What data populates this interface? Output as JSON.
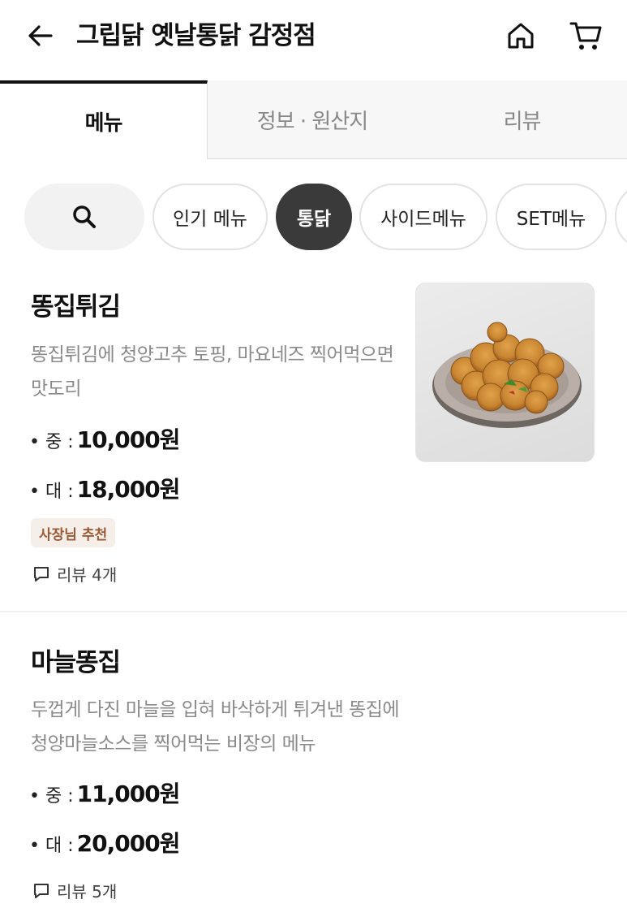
{
  "header": {
    "title": "그립닭 옛날통닭 감정점",
    "icons": {
      "back": "arrow-left-icon",
      "home": "home-icon",
      "cart": "cart-icon"
    }
  },
  "tabs": [
    {
      "label": "메뉴",
      "active": true
    },
    {
      "label": "정보 · 원산지",
      "active": false
    },
    {
      "label": "리뷰",
      "active": false
    }
  ],
  "categories": [
    {
      "label": "인기 메뉴",
      "active": false
    },
    {
      "label": "통닭",
      "active": true
    },
    {
      "label": "사이드메뉴",
      "active": false
    },
    {
      "label": "SET메뉴",
      "active": false
    }
  ],
  "menu_items": [
    {
      "name": "똥집튀김",
      "description_lines": [
        "똥집튀김에 청양고추 토핑, 마요네즈 찍어먹으면",
        "맛도리"
      ],
      "prices": [
        {
          "label": "• 중 :",
          "value": "10,000원"
        },
        {
          "label": "• 대 :",
          "value": "18,000원"
        }
      ],
      "badge": "사장님 추천",
      "review": "리뷰 4개"
    },
    {
      "name": "마늘똥집",
      "description_lines": [
        "두껍게 다진 마늘을 입혀 바삭하게 튀겨낸 똥집에",
        "청양마늘소스를 찍어먹는 비장의 메뉴"
      ],
      "prices": [
        {
          "label": "• 중 :",
          "value": "11,000원"
        },
        {
          "label": "• 대 :",
          "value": "20,000원"
        }
      ],
      "review": "리뷰 5개"
    }
  ],
  "colors": {
    "active_tab_border": "#111111",
    "active_chip_bg": "#3a3a3a",
    "badge_bg": "#f6eee8",
    "badge_text": "#9a5a35"
  }
}
